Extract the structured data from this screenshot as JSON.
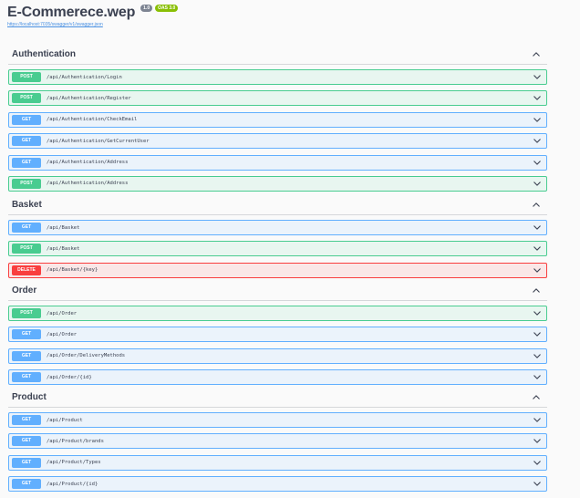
{
  "header": {
    "title": "E-Commerece.wep",
    "version_badge": "1.0",
    "oas_badge": "OAS 3.0",
    "spec_link": "https://localhost:7035/swagger/v1/swagger.json"
  },
  "sections": [
    {
      "title": "Authentication",
      "operations": [
        {
          "method": "POST",
          "path": "/api/Authentication/Login"
        },
        {
          "method": "POST",
          "path": "/api/Authentication/Register"
        },
        {
          "method": "GET",
          "path": "/api/Authentication/CheckEmail"
        },
        {
          "method": "GET",
          "path": "/api/Authentication/GetCurrentUser"
        },
        {
          "method": "GET",
          "path": "/api/Authentication/Address"
        },
        {
          "method": "POST",
          "path": "/api/Authentication/Address"
        }
      ]
    },
    {
      "title": "Basket",
      "operations": [
        {
          "method": "GET",
          "path": "/api/Basket"
        },
        {
          "method": "POST",
          "path": "/api/Basket"
        },
        {
          "method": "DELETE",
          "path": "/api/Basket/{key}"
        }
      ]
    },
    {
      "title": "Order",
      "operations": [
        {
          "method": "POST",
          "path": "/api/Order"
        },
        {
          "method": "GET",
          "path": "/api/Order"
        },
        {
          "method": "GET",
          "path": "/api/Order/DeliveryMethods"
        },
        {
          "method": "GET",
          "path": "/api/Order/{id}"
        }
      ]
    },
    {
      "title": "Product",
      "operations": [
        {
          "method": "GET",
          "path": "/api/Product"
        },
        {
          "method": "GET",
          "path": "/api/Product/brands"
        },
        {
          "method": "GET",
          "path": "/api/Product/Types"
        },
        {
          "method": "GET",
          "path": "/api/Product/{id}"
        }
      ]
    }
  ],
  "colors": {
    "post": "#49cc90",
    "get": "#61affe",
    "delete": "#f93e3e",
    "oas_badge": "#89bf04",
    "version_badge": "#7d8492",
    "link": "#4990e2"
  },
  "icons": {
    "section_toggle": "chevron-up-icon",
    "operation_toggle": "chevron-down-icon"
  }
}
